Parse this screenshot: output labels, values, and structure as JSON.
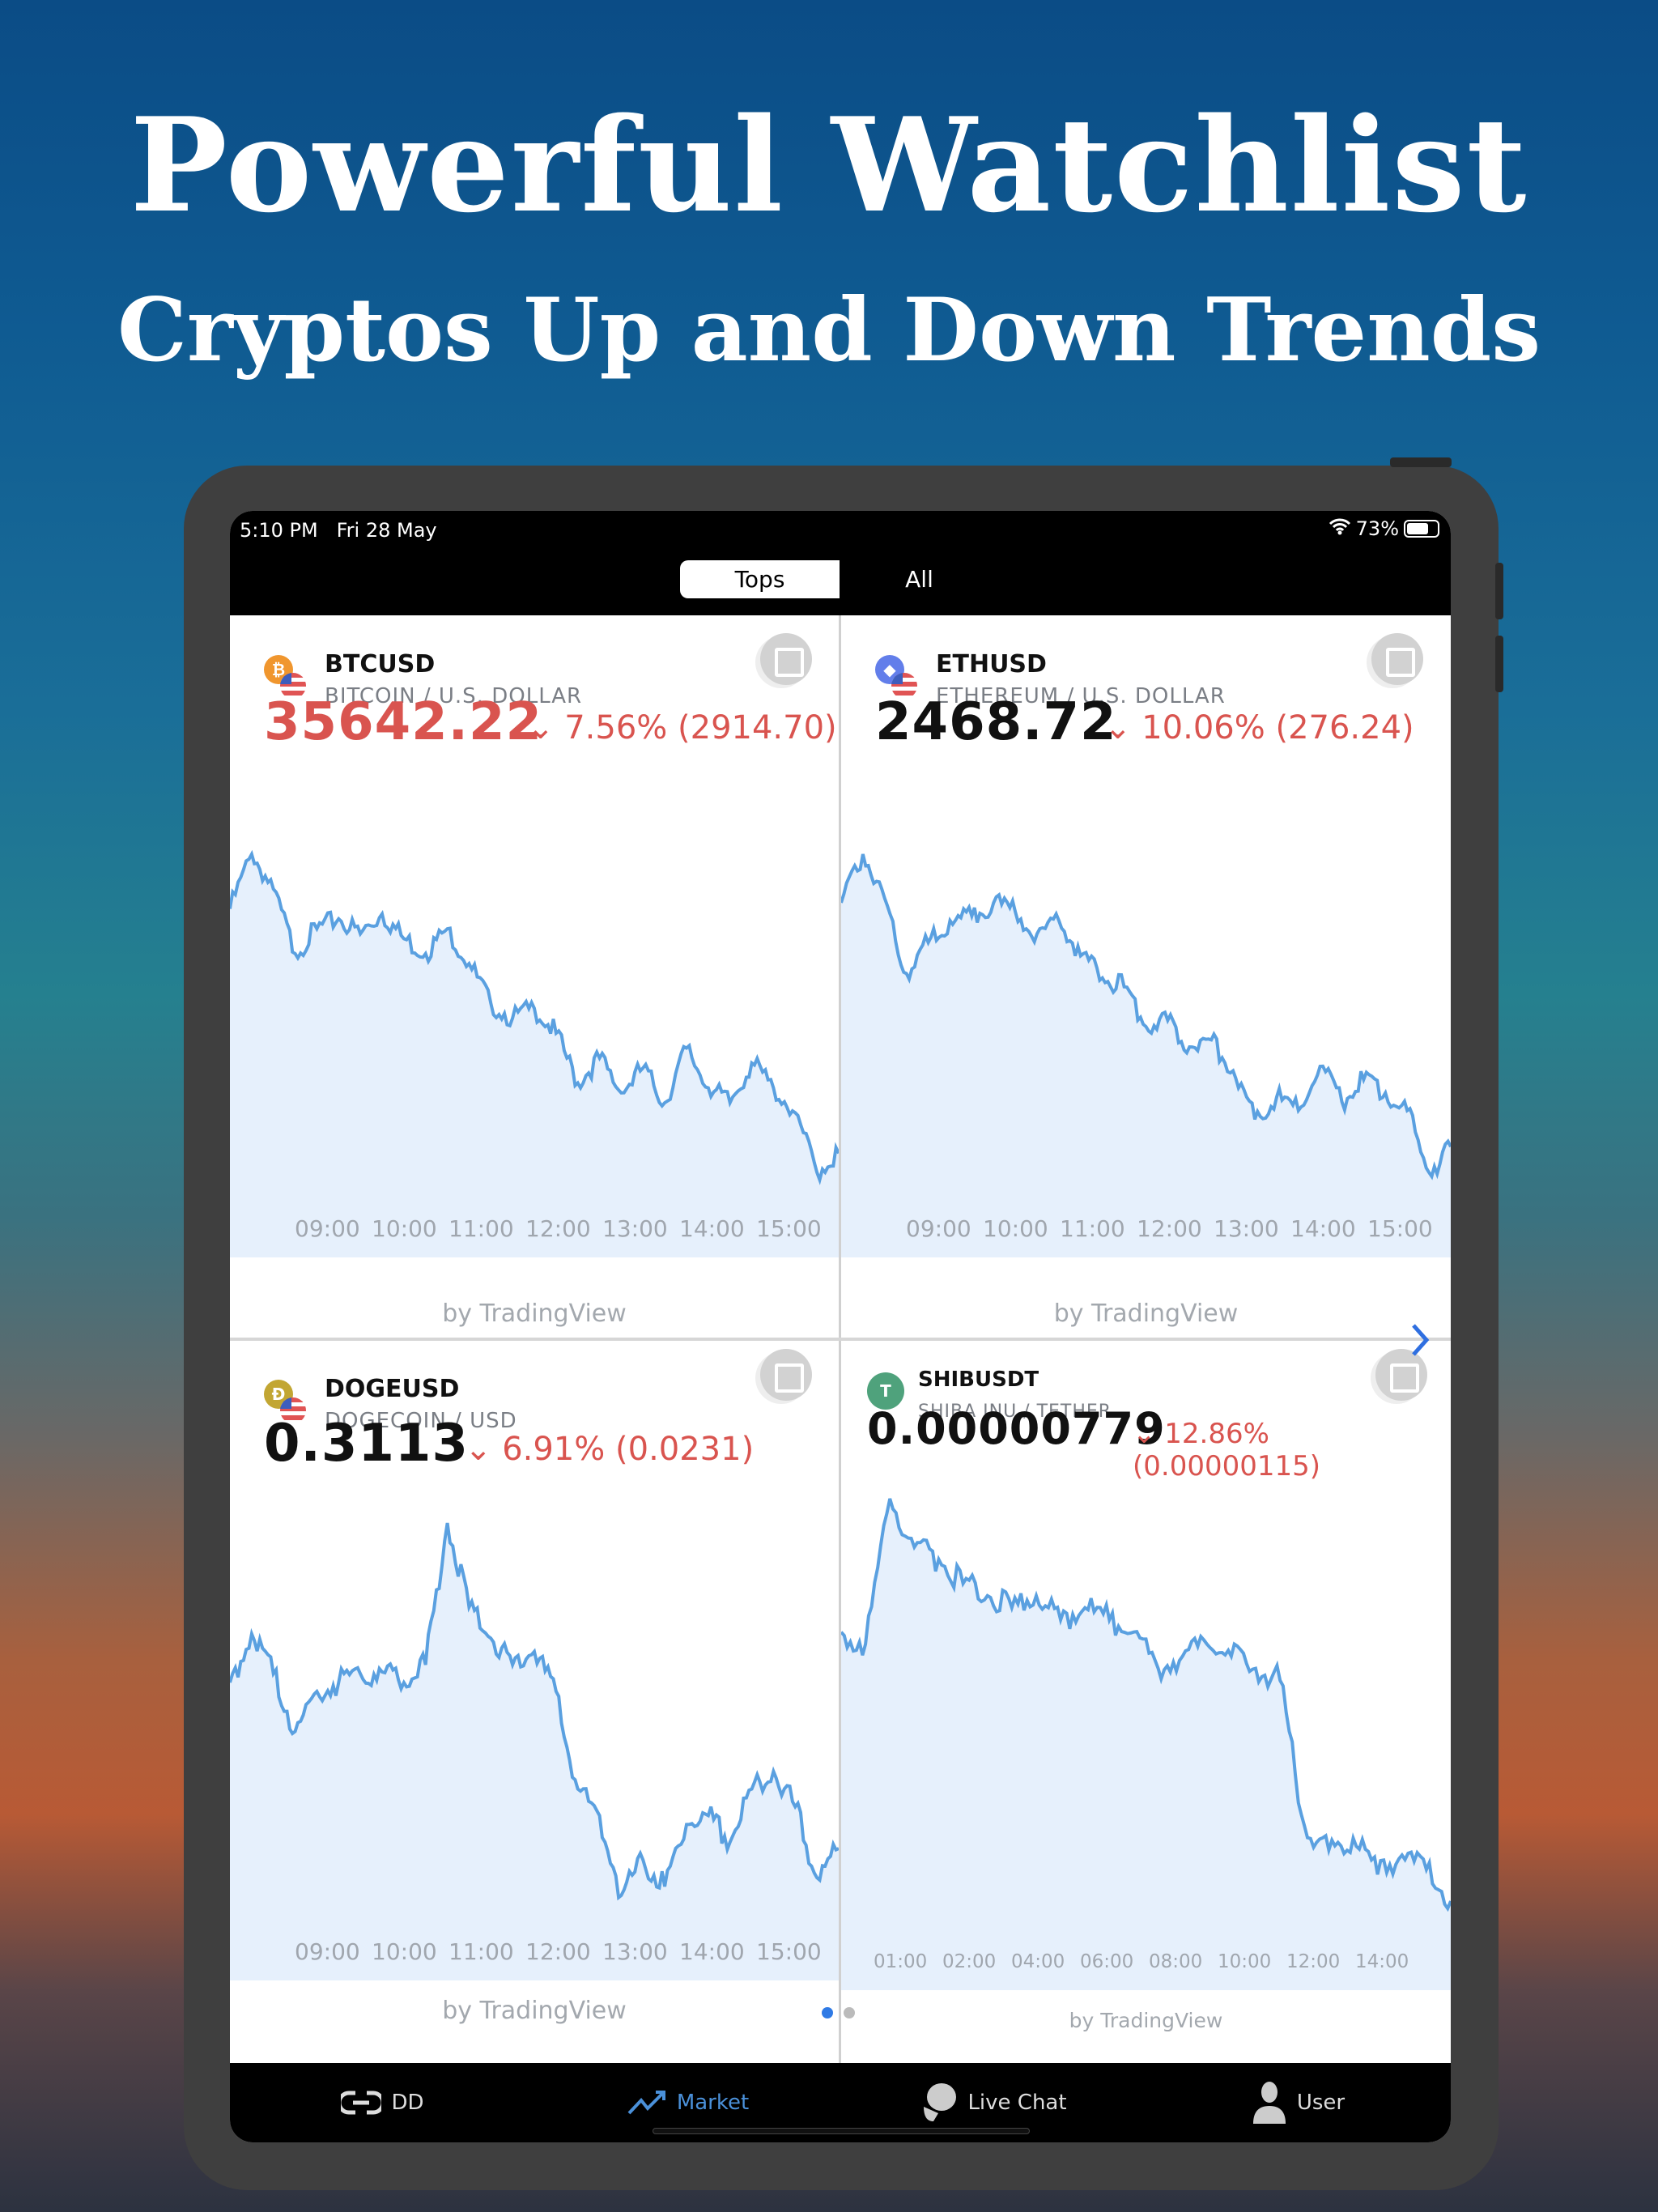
{
  "headline": {
    "title": "Powerful Watchlist",
    "subtitle": "Cryptos Up and Down Trends"
  },
  "status": {
    "time": "5:10 PM",
    "date": "Fri 28 May",
    "battery": "73%",
    "battery_level": 0.73
  },
  "tabs": [
    {
      "label": "Tops",
      "active": true
    },
    {
      "label": "All",
      "active": false
    }
  ],
  "colors": {
    "down": "#d9544f",
    "line": "#5aa0e0",
    "fill": "#e6f0fc",
    "active_nav": "#4a90d9"
  },
  "cards": [
    {
      "ticker": "BTCUSD",
      "pair": "BITCOIN / U.S. DOLLAR",
      "price": "35642.22",
      "price_color": "#d9544f",
      "change": "⌄ 7.56% (2914.70)",
      "coin_icon": "bitcoin-icon",
      "coin_color": "#f0962e",
      "coin_glyph": "₿",
      "x_labels": [
        "09:00",
        "10:00",
        "11:00",
        "12:00",
        "13:00",
        "14:00",
        "15:00"
      ],
      "attribution": "by TradingView",
      "series": [
        38100,
        38650,
        38300,
        37650,
        37900,
        38000,
        37850,
        38050,
        37800,
        37650,
        37900,
        37550,
        37150,
        37000,
        37100,
        36850,
        36350,
        36600,
        36250,
        36500,
        36150,
        36700,
        36300,
        36150,
        36550,
        36300,
        36050,
        35450,
        35642
      ]
    },
    {
      "ticker": "ETHUSD",
      "pair": "ETHEREUM / U.S. DOLLAR",
      "price": "2468.72",
      "price_color": "#111111",
      "change": "⌄ 10.06% (276.24)",
      "coin_icon": "ethereum-icon",
      "coin_color": "#627eea",
      "coin_glyph": "◆",
      "x_labels": [
        "09:00",
        "10:00",
        "11:00",
        "12:00",
        "13:00",
        "14:00",
        "15:00"
      ],
      "attribution": "by TradingView",
      "series": [
        2745,
        2800,
        2750,
        2665,
        2700,
        2725,
        2730,
        2745,
        2735,
        2710,
        2725,
        2685,
        2660,
        2650,
        2605,
        2612,
        2582,
        2590,
        2555,
        2500,
        2525,
        2510,
        2560,
        2520,
        2545,
        2530,
        2510,
        2440,
        2469
      ]
    },
    {
      "ticker": "DOGEUSD",
      "pair": "DOGECOIN / USD",
      "price": "0.3113",
      "price_color": "#111111",
      "change": "⌄ 6.91% (0.0231)",
      "coin_icon": "dogecoin-icon",
      "coin_color": "#c2a633",
      "coin_glyph": "Ð",
      "x_labels": [
        "09:00",
        "10:00",
        "11:00",
        "12:00",
        "13:00",
        "14:00",
        "15:00"
      ],
      "attribution": "by TradingView",
      "series": [
        0.33,
        0.3355,
        0.331,
        0.3245,
        0.329,
        0.33,
        0.331,
        0.3312,
        0.33,
        0.332,
        0.348,
        0.3385,
        0.335,
        0.332,
        0.3335,
        0.329,
        0.318,
        0.315,
        0.306,
        0.31,
        0.307,
        0.314,
        0.315,
        0.312,
        0.318,
        0.32,
        0.316,
        0.308,
        0.3113
      ]
    },
    {
      "ticker": "SHIBUSDT",
      "pair": "SHIBA INU / TETHER",
      "price": "0.00000779",
      "price_color": "#111111",
      "change": "⌄ 12.86% (0.00000115)",
      "coin_icon": "tether-icon",
      "coin_color": "#4fa27c",
      "coin_glyph": "T",
      "x_labels": [
        "01:00",
        "02:00",
        "04:00",
        "06:00",
        "08:00",
        "10:00",
        "12:00",
        "14:00"
      ],
      "attribution": "by TradingView",
      "series": [
        8.9e-06,
        8.85e-06,
        9.45e-06,
        9.25e-06,
        9.2e-06,
        9.1e-06,
        9.05e-06,
        9e-06,
        9.05e-06,
        8.95e-06,
        9e-06,
        8.95e-06,
        8.9e-06,
        8.75e-06,
        8.8e-06,
        8.85e-06,
        8.8e-06,
        8.75e-06,
        8.7e-06,
        8.1e-06,
        8e-06,
        8.05e-06,
        7.9e-06,
        7.98e-06,
        7.92e-06,
        7.79e-06
      ]
    }
  ],
  "pager": {
    "pages": 2,
    "current": 1
  },
  "nav": [
    {
      "label": "DD",
      "icon": "link-icon"
    },
    {
      "label": "Market",
      "icon": "trend-icon",
      "active": true
    },
    {
      "label": "Live Chat",
      "icon": "chat-icon"
    },
    {
      "label": "User",
      "icon": "user-icon"
    }
  ]
}
